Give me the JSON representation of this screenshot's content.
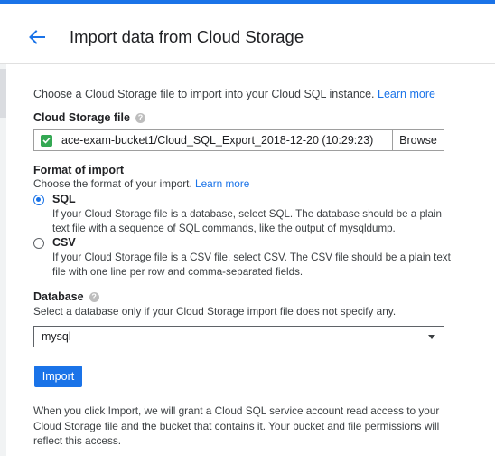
{
  "header": {
    "title": "Import data from Cloud Storage",
    "back_icon": "arrow-back-icon",
    "accent_color": "#1a73e8"
  },
  "intro": {
    "text": "Choose a Cloud Storage file to import into your Cloud SQL instance.",
    "learn_more": "Learn more"
  },
  "storage_file": {
    "label": "Cloud Storage file",
    "value": "ace-exam-bucket1/Cloud_SQL_Export_2018-12-20 (10:29:23)",
    "browse_label": "Browse",
    "status_icon": "check-icon"
  },
  "format": {
    "label": "Format of import",
    "subtitle": "Choose the format of your import.",
    "learn_more": "Learn more",
    "options": [
      {
        "label": "SQL",
        "selected": true,
        "desc_line1": "If your Cloud Storage file is a database, select SQL. The database should be a plain",
        "desc_line2": "text file with a sequence of SQL commands, like the output of mysqldump."
      },
      {
        "label": "CSV",
        "selected": false,
        "desc_line1": "If your Cloud Storage file is a CSV file, select CSV. The CSV file should be a plain text",
        "desc_line2": "file with one line per row and comma-separated fields."
      }
    ]
  },
  "database": {
    "label": "Database",
    "subtitle": "Select a database only if your Cloud Storage import file does not specify any.",
    "value": "mysql"
  },
  "actions": {
    "import_label": "Import"
  },
  "footer": {
    "line1": "When you click Import, we will grant a Cloud SQL service account read access to your",
    "line2": "Cloud Storage file and the bucket that contains it. Your bucket and file permissions will",
    "line3": "reflect this access."
  }
}
